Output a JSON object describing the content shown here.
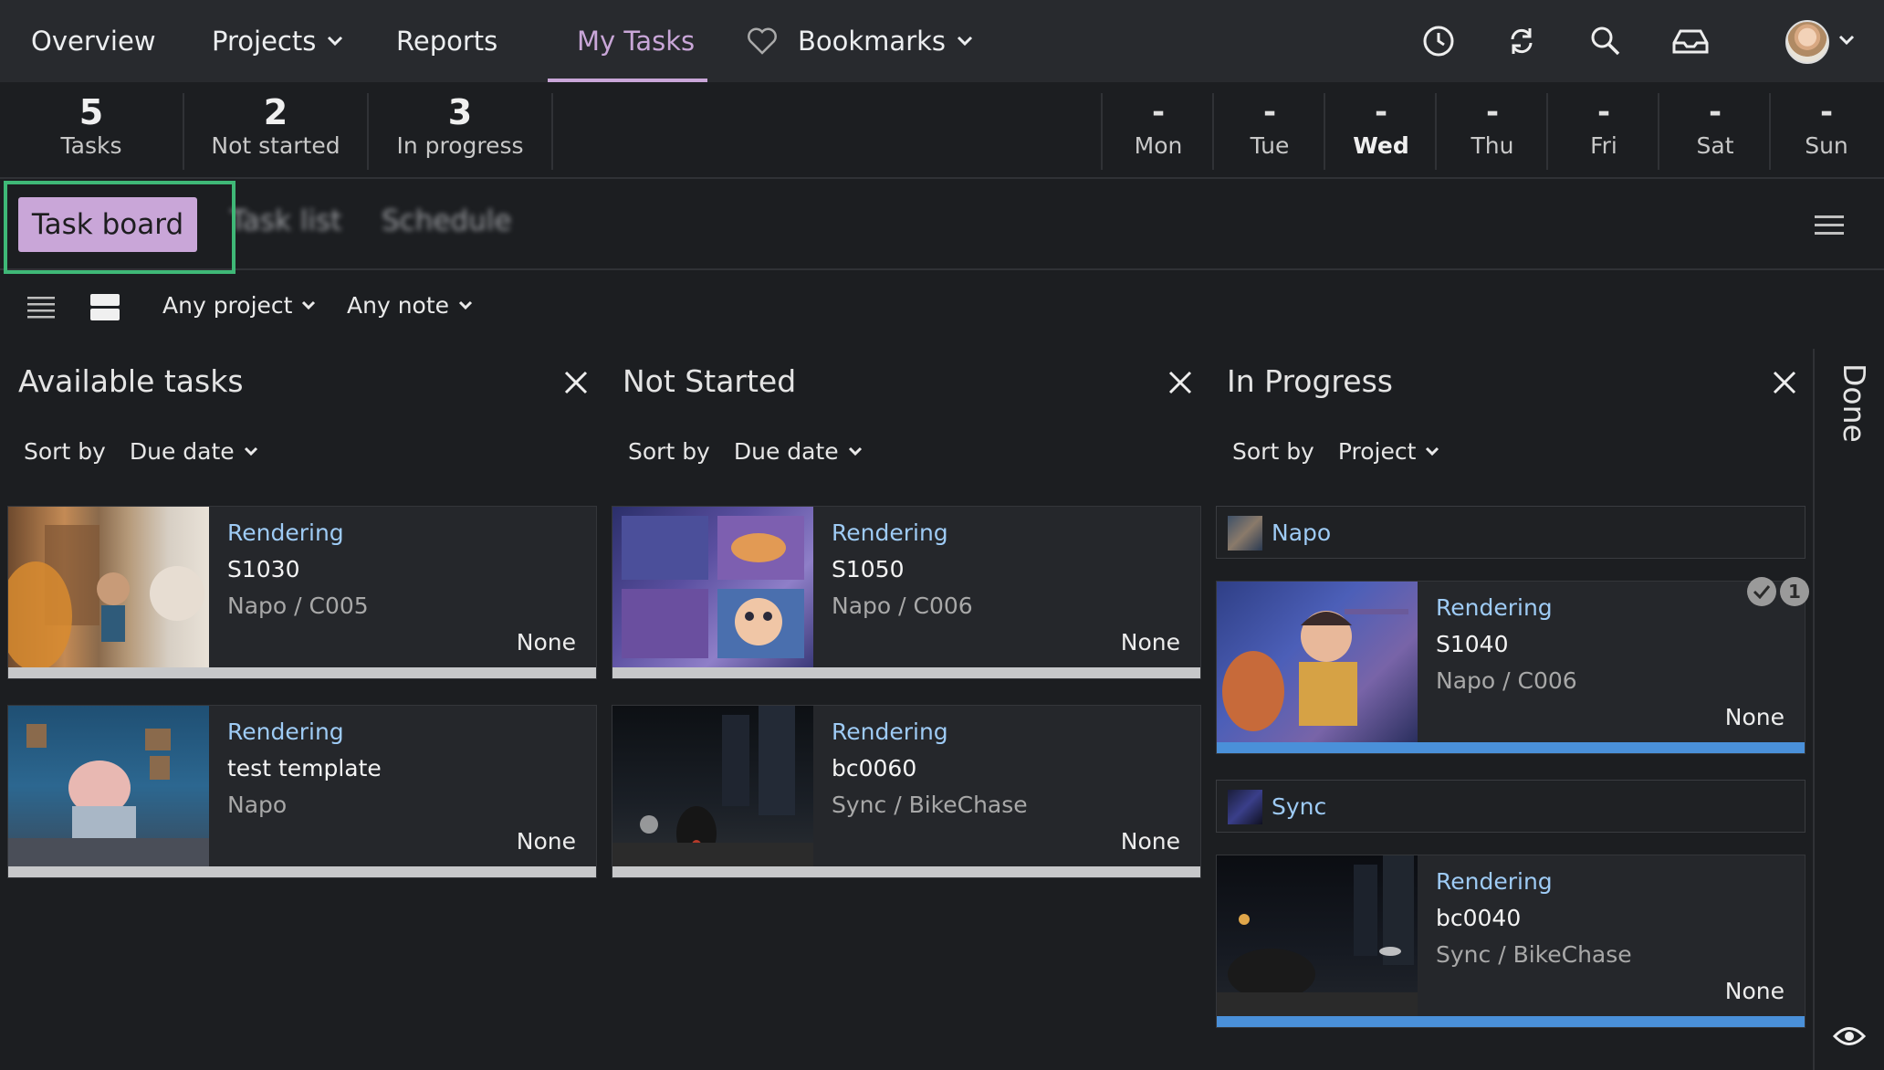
{
  "nav": {
    "overview": "Overview",
    "projects": "Projects",
    "reports": "Reports",
    "my_tasks": "My Tasks",
    "bookmarks": "Bookmarks",
    "icons": [
      "heart-icon",
      "clock-icon",
      "sync-icon",
      "search-icon",
      "inbox-icon",
      "avatar"
    ]
  },
  "stats": {
    "tasks": {
      "num": "5",
      "label": "Tasks"
    },
    "not_started": {
      "num": "2",
      "label": "Not started"
    },
    "in_progress": {
      "num": "3",
      "label": "In progress"
    }
  },
  "days": [
    {
      "dash": "-",
      "name": "Mon"
    },
    {
      "dash": "-",
      "name": "Tue"
    },
    {
      "dash": "-",
      "name": "Wed"
    },
    {
      "dash": "-",
      "name": "Thu"
    },
    {
      "dash": "-",
      "name": "Fri"
    },
    {
      "dash": "-",
      "name": "Sat"
    },
    {
      "dash": "-",
      "name": "Sun"
    }
  ],
  "tabs": {
    "task_board": "Task board",
    "task_list": "Task list",
    "schedule": "Schedule"
  },
  "filters": {
    "project": "Any project",
    "note": "Any note"
  },
  "columns": {
    "available": {
      "title": "Available tasks",
      "sort_label": "Sort by",
      "sort_value": "Due date",
      "cards": [
        {
          "type": "Rendering",
          "name": "S1030",
          "path": "Napo / C005",
          "status": "None"
        },
        {
          "type": "Rendering",
          "name": "test template",
          "path": "Napo",
          "status": "None"
        }
      ]
    },
    "not_started": {
      "title": "Not Started",
      "sort_label": "Sort by",
      "sort_value": "Due date",
      "cards": [
        {
          "type": "Rendering",
          "name": "S1050",
          "path": "Napo / C006",
          "status": "None"
        },
        {
          "type": "Rendering",
          "name": "bc0060",
          "path": "Sync / BikeChase",
          "status": "None"
        }
      ]
    },
    "in_progress": {
      "title": "In Progress",
      "sort_label": "Sort by",
      "sort_value": "Project",
      "groups": [
        {
          "label": "Napo"
        },
        {
          "label": "Sync"
        }
      ],
      "cards": [
        {
          "type": "Rendering",
          "name": "S1040",
          "path": "Napo / C006",
          "status": "None",
          "note_count": "1"
        },
        {
          "type": "Rendering",
          "name": "bc0040",
          "path": "Sync / BikeChase",
          "status": "None"
        }
      ]
    }
  },
  "done_panel": {
    "label": "Done"
  },
  "colors": {
    "accent": "#c9a6d8",
    "highlight": "#3fb877",
    "link": "#9ecbf5",
    "progress": "#4a90d9"
  }
}
